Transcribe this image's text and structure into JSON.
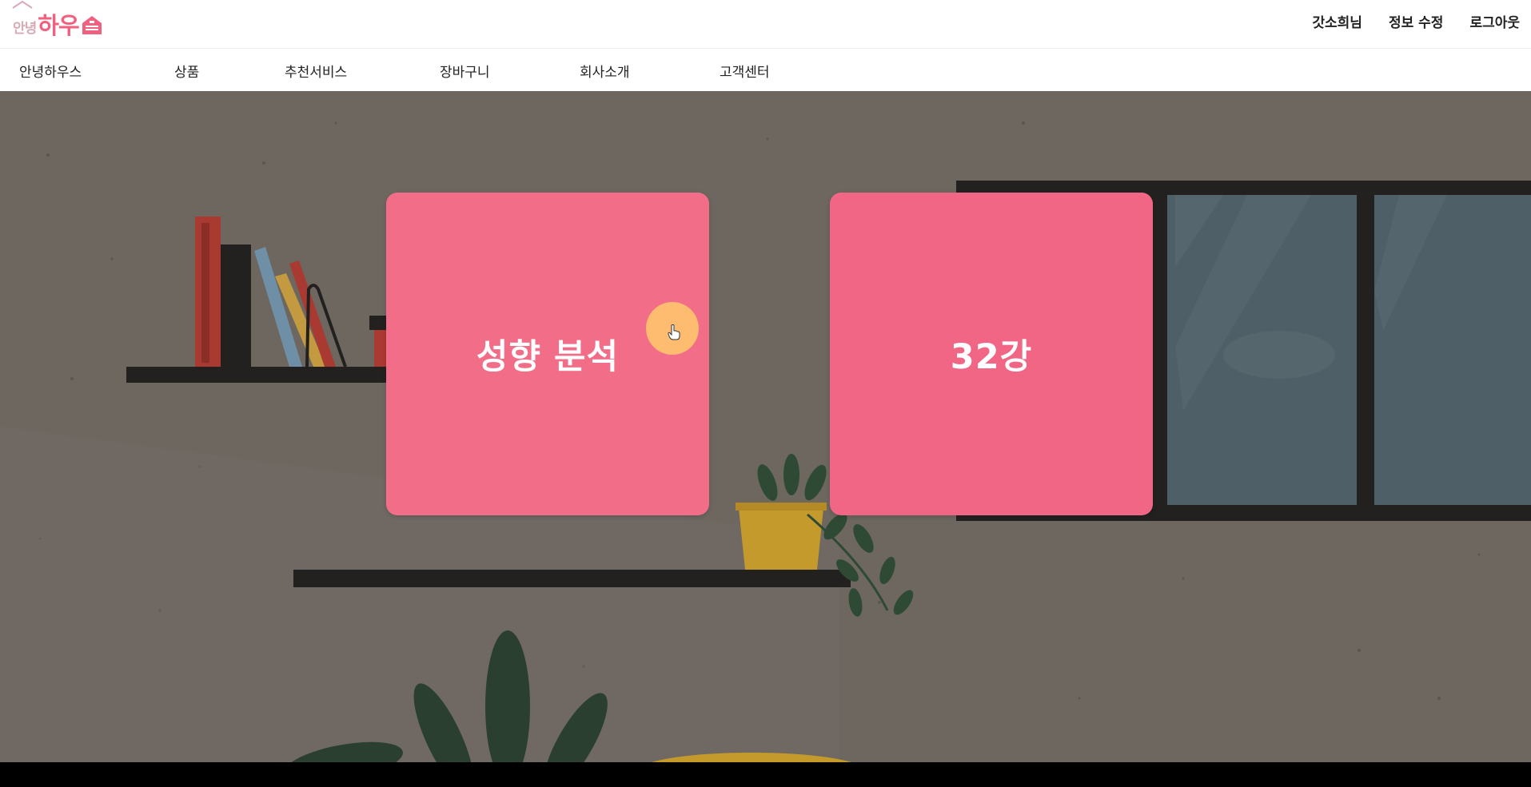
{
  "header": {
    "logo": {
      "small_text": "안녕",
      "big_text": "하우",
      "icon": "house-icon"
    },
    "user_nav": {
      "username": "갓소희님",
      "edit_profile": "정보 수정",
      "logout": "로그아웃"
    }
  },
  "nav": {
    "items": [
      {
        "label": "안녕하우스"
      },
      {
        "label": "상품"
      },
      {
        "label": "추천서비스"
      },
      {
        "label": "장바구니"
      },
      {
        "label": "회사소개"
      },
      {
        "label": "고객센터"
      }
    ]
  },
  "hero": {
    "cards": [
      {
        "label": "성향 분석",
        "color": "#f26e88"
      },
      {
        "label": "32강",
        "color": "#f26685"
      }
    ]
  },
  "colors": {
    "brand_pink": "#f2607f",
    "logo_light": "#d9aab6",
    "hero_background": "#6d6760",
    "cursor_highlight": "#ffc26e"
  },
  "icons": [
    "house-icon",
    "hand-pointer-icon"
  ]
}
